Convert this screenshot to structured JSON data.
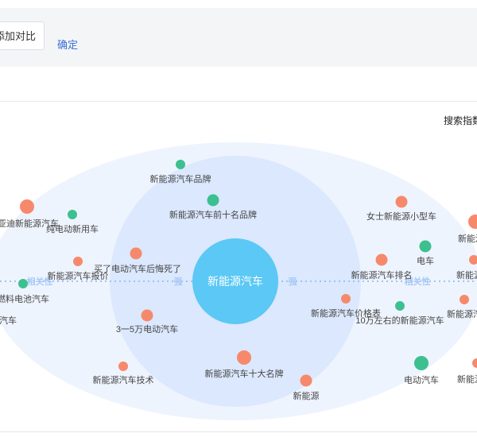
{
  "toolbar": {
    "add_compare_label": "添加对比",
    "confirm_label": "确定"
  },
  "search_index_label": "搜索指数",
  "center": {
    "label": "新能源汽车",
    "color": "#5bc8f5"
  },
  "axis": {
    "left_label": "相关性",
    "right_label": "相关性",
    "near_left": "强",
    "near_right": "强"
  },
  "colors": {
    "rising": "#f6896c",
    "falling": "#3cc08f",
    "ring_inner": "#dbe8fd",
    "ring_outer": "#eef4fe"
  },
  "nodes": [
    {
      "label": "新能源汽车品牌",
      "trend": "falling",
      "size": "small"
    },
    {
      "label": "新能源汽车前十名品牌",
      "trend": "falling",
      "size": "medium"
    },
    {
      "label": "比亚迪新能源汽车",
      "trend": "rising",
      "size": "large"
    },
    {
      "label": "纯电动新用车",
      "trend": "falling",
      "size": "small"
    },
    {
      "label": "新能源汽车报价",
      "trend": "rising",
      "size": "small"
    },
    {
      "label": "买了电动汽车后悔死了",
      "trend": "rising",
      "size": "medium"
    },
    {
      "label": "燃料电池汽车",
      "trend": "falling",
      "size": "small"
    },
    {
      "label": "汽车",
      "trend": "rising",
      "size": "small"
    },
    {
      "label": "3一5万电动汽车",
      "trend": "rising",
      "size": "medium"
    },
    {
      "label": "新能源汽车技术",
      "trend": "rising",
      "size": "small"
    },
    {
      "label": "新能源汽车十大名牌",
      "trend": "rising",
      "size": "large"
    },
    {
      "label": "新能源",
      "trend": "rising",
      "size": "medium"
    },
    {
      "label": "女士新能源小型车",
      "trend": "rising",
      "size": "medium"
    },
    {
      "label": "新能源汽",
      "trend": "rising",
      "size": "large"
    },
    {
      "label": "电车",
      "trend": "falling",
      "size": "medium"
    },
    {
      "label": "新能源汽车排名",
      "trend": "rising",
      "size": "medium"
    },
    {
      "label": "新能源汽",
      "trend": "rising",
      "size": "small"
    },
    {
      "label": "新能源汽车价格表",
      "trend": "rising",
      "size": "small"
    },
    {
      "label": "10万左右的新能源汽车",
      "trend": "falling",
      "size": "small"
    },
    {
      "label": "新能源汽",
      "trend": "rising",
      "size": "small"
    },
    {
      "label": "电动汽车",
      "trend": "falling",
      "size": "large"
    },
    {
      "label": "新能源汽",
      "trend": "rising",
      "size": "small"
    }
  ]
}
